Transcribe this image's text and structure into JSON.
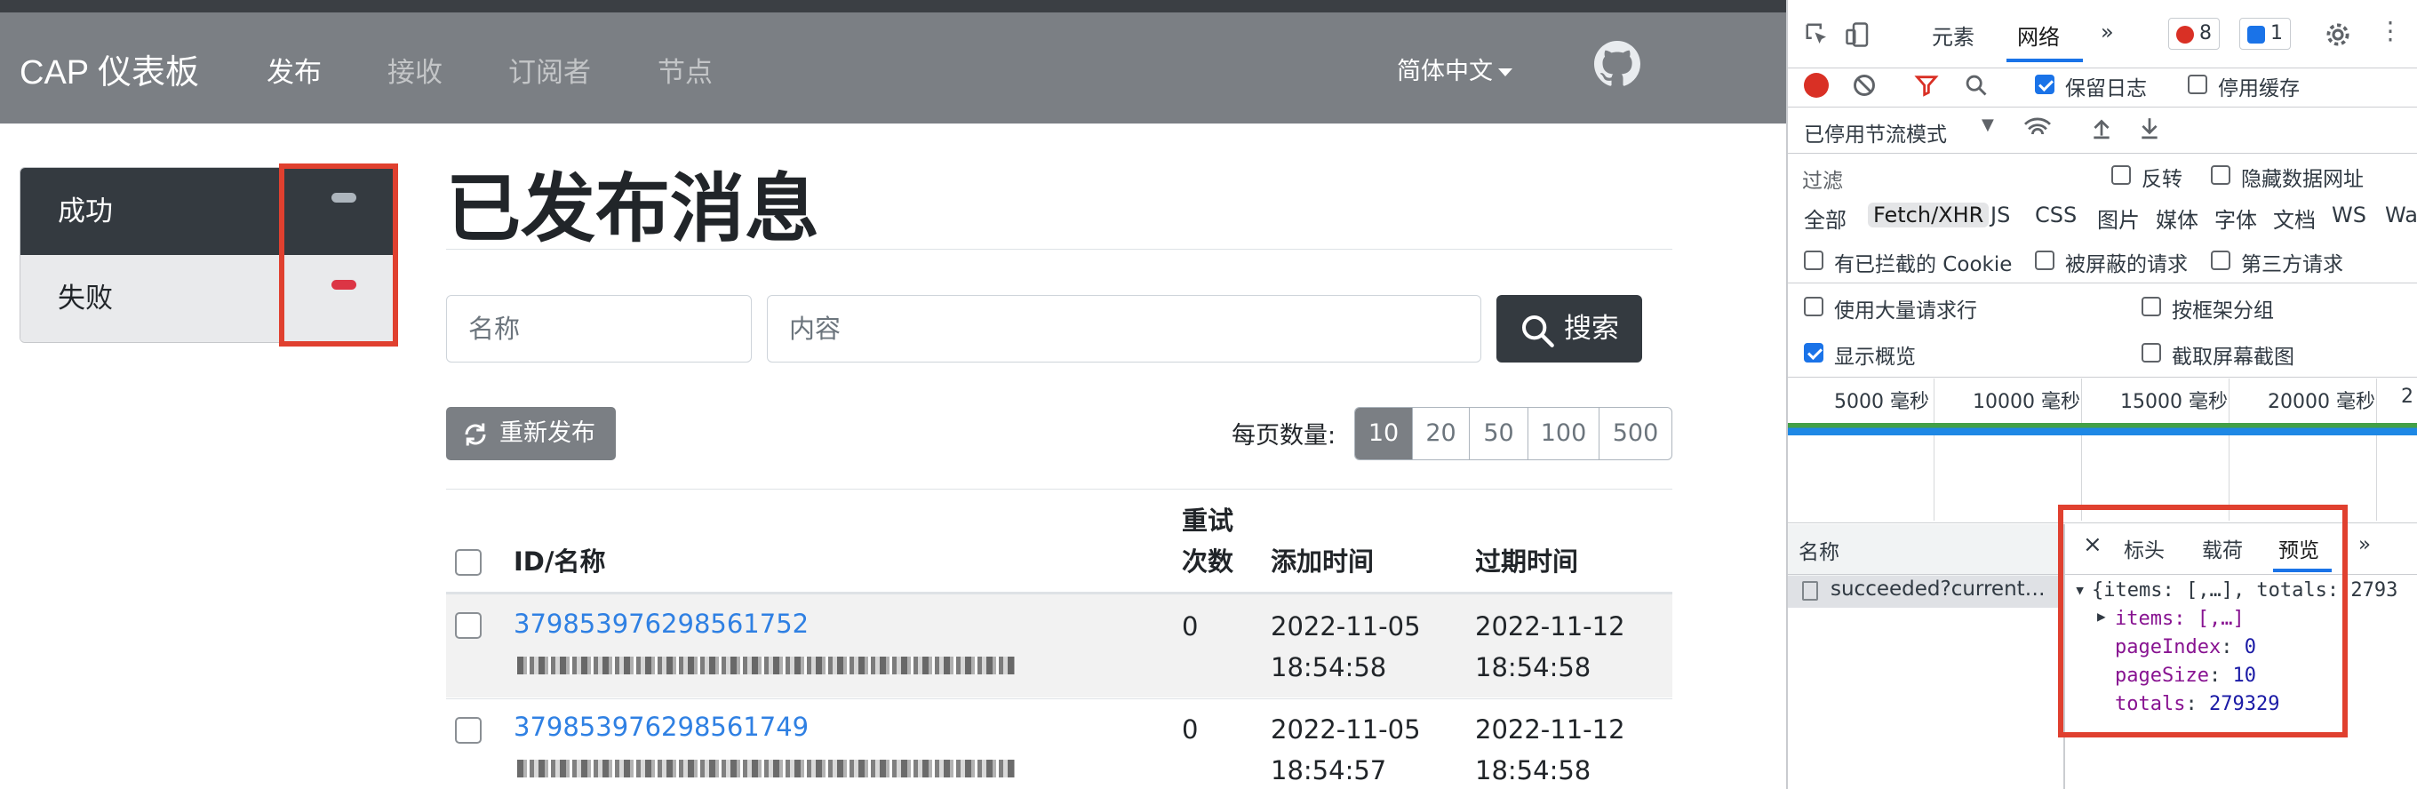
{
  "navbar": {
    "brand": "CAP 仪表板",
    "links": [
      {
        "label": "发布",
        "active": true
      },
      {
        "label": "接收",
        "active": false
      },
      {
        "label": "订阅者",
        "active": false
      },
      {
        "label": "节点",
        "active": false
      }
    ],
    "language": "简体中文",
    "github_icon": "github-icon"
  },
  "sidebar": {
    "items": [
      {
        "label": "成功",
        "badge_color": "#adb5bd",
        "active": true
      },
      {
        "label": "失败",
        "badge_color": "#dc3545",
        "active": false
      }
    ]
  },
  "main": {
    "title": "已发布消息",
    "search": {
      "name_placeholder": "名称",
      "content_placeholder": "内容",
      "button_label": "搜索"
    },
    "retry_button": "重新发布",
    "page_size": {
      "label": "每页数量:",
      "options": [
        "10",
        "20",
        "50",
        "100",
        "500"
      ],
      "selected": "10"
    },
    "table": {
      "headers": {
        "id_name": "ID/名称",
        "retries_line1": "重试",
        "retries_line2": "次数",
        "added": "添加时间",
        "expires": "过期时间"
      },
      "rows": [
        {
          "id": "379853976298561752",
          "retries": "0",
          "added_date": "2022-11-05",
          "added_time": "18:54:58",
          "expires_date": "2022-11-12",
          "expires_time": "18:54:58"
        },
        {
          "id": "379853976298561749",
          "retries": "0",
          "added_date": "2022-11-05",
          "added_time": "18:54:57",
          "expires_date": "2022-11-12",
          "expires_time": "18:54:58"
        }
      ]
    }
  },
  "devtools": {
    "tabs": [
      "元素",
      "网络",
      "»"
    ],
    "active_tab": "网络",
    "error_count": "8",
    "message_count": "1",
    "toolbar": {
      "preserve_log": "保留日志",
      "disable_cache": "停用缓存",
      "throttling": "已停用节流模式"
    },
    "filter": {
      "placeholder": "过滤",
      "invert": "反转",
      "hide_data_urls": "隐藏数据网址"
    },
    "types": [
      "全部",
      "Fetch/XHR",
      "JS",
      "CSS",
      "图片",
      "媒体",
      "字体",
      "文档",
      "WS",
      "Wa"
    ],
    "active_type": "Fetch/XHR",
    "options": {
      "blocked_cookies": "有已拦截的 Cookie",
      "blocked_requests": "被屏蔽的请求",
      "third_party": "第三方请求",
      "large_rows": "使用大量请求行",
      "group_by_frame": "按框架分组",
      "show_overview": "显示概览",
      "screenshots": "截取屏幕截图"
    },
    "timeline_ticks": [
      "5000 毫秒",
      "10000 毫秒",
      "15000 毫秒",
      "20000 毫秒",
      "2"
    ],
    "requests": {
      "name_header": "名称",
      "items": [
        "succeeded?current…"
      ]
    },
    "detail_tabs": [
      "标头",
      "载荷",
      "预览",
      "»"
    ],
    "active_detail_tab": "预览",
    "preview": {
      "summary": "{items: [,…], totals: 2793",
      "items_line": "items: [,…]",
      "page_index_key": "pageIndex",
      "page_index": "0",
      "page_size_key": "pageSize",
      "page_size": "10",
      "totals_key": "totals",
      "totals": "279329"
    }
  },
  "colors": {
    "navbar": "#7b7f84",
    "sidebar_active": "#343a40",
    "link": "#2f80e3",
    "highlight_box": "#e0402f",
    "devtools_accent": "#1a73e8"
  }
}
